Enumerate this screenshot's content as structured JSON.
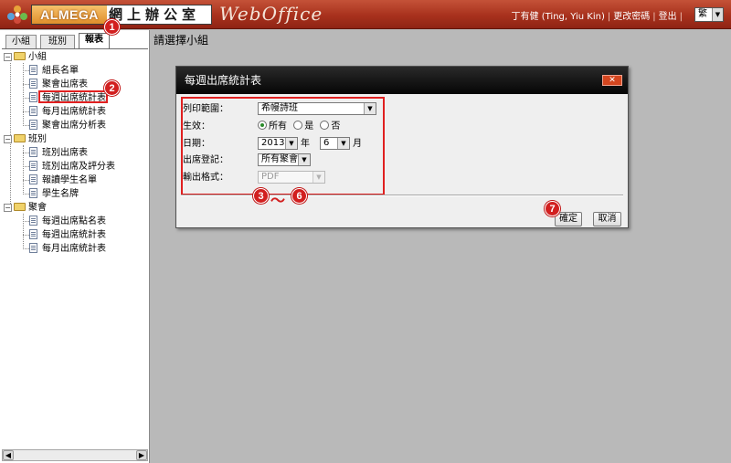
{
  "header": {
    "brand": "ALMEGA",
    "brand_cjk": "網上辦公室",
    "wordmark": "WebOffice",
    "user": "丁有健 (Ting, Yiu Kin)",
    "change_password": "更改密碼",
    "logout": "登出",
    "language": "繁"
  },
  "tabs": [
    "小組",
    "班別",
    "報表"
  ],
  "tree": {
    "groups": [
      {
        "label": "小組",
        "items": [
          "組長名單",
          "聚會出席表",
          "每週出席統計表",
          "每月出席統計表",
          "聚會出席分析表"
        ]
      },
      {
        "label": "班別",
        "items": [
          "班別出席表",
          "班別出席及評分表",
          "報讀學生名單",
          "學生名牌"
        ]
      },
      {
        "label": "聚會",
        "items": [
          "每週出席點名表",
          "每週出席統計表",
          "每月出席統計表"
        ]
      }
    ]
  },
  "main": {
    "title": "請選擇小組"
  },
  "dialog": {
    "title": "每週出席統計表",
    "close": "✕",
    "fields": {
      "range_label": "列印範圍：",
      "range_value": "希幔詩班",
      "status_label": "生效：",
      "status_options": [
        "所有",
        "是",
        "否"
      ],
      "status_selected": "所有",
      "date_label": "日期：",
      "year_value": "2013",
      "year_unit": "年",
      "month_value": "6",
      "month_unit": "月",
      "attendance_label": "出席登記：",
      "attendance_value": "所有聚會",
      "format_label": "輸出格式：",
      "format_value": "PDF"
    },
    "ok": "確定",
    "cancel": "取消"
  },
  "annotations": {
    "b1": "1",
    "b2": "2",
    "b3": "3",
    "tilde": "～",
    "b6": "6",
    "b7": "7"
  },
  "colors": {
    "header_red": "#a8311d",
    "annotation_red": "#d21f1f",
    "dialog_title": "#050505"
  }
}
